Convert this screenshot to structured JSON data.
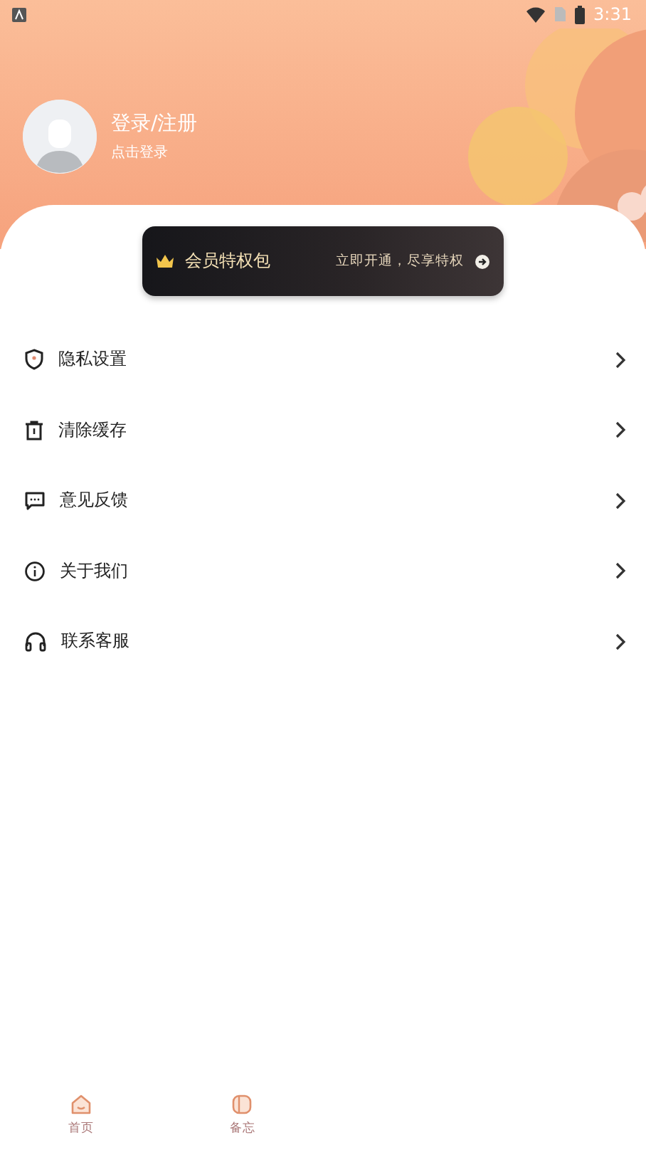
{
  "status_bar": {
    "time": "3:31"
  },
  "profile": {
    "title": "登录/注册",
    "subtitle": "点击登录"
  },
  "vip_banner": {
    "title": "会员特权包",
    "action": "立即开通，尽享特权"
  },
  "menu": [
    {
      "label": "隐私设置",
      "kind": "shield"
    },
    {
      "label": "清除缓存",
      "kind": "trash"
    },
    {
      "label": "意见反馈",
      "kind": "message"
    },
    {
      "label": "关于我们",
      "kind": "info"
    },
    {
      "label": "联系客服",
      "kind": "headset"
    }
  ],
  "bottom_nav": [
    {
      "label": "首页",
      "kind": "home"
    },
    {
      "label": "备忘",
      "kind": "note"
    }
  ]
}
